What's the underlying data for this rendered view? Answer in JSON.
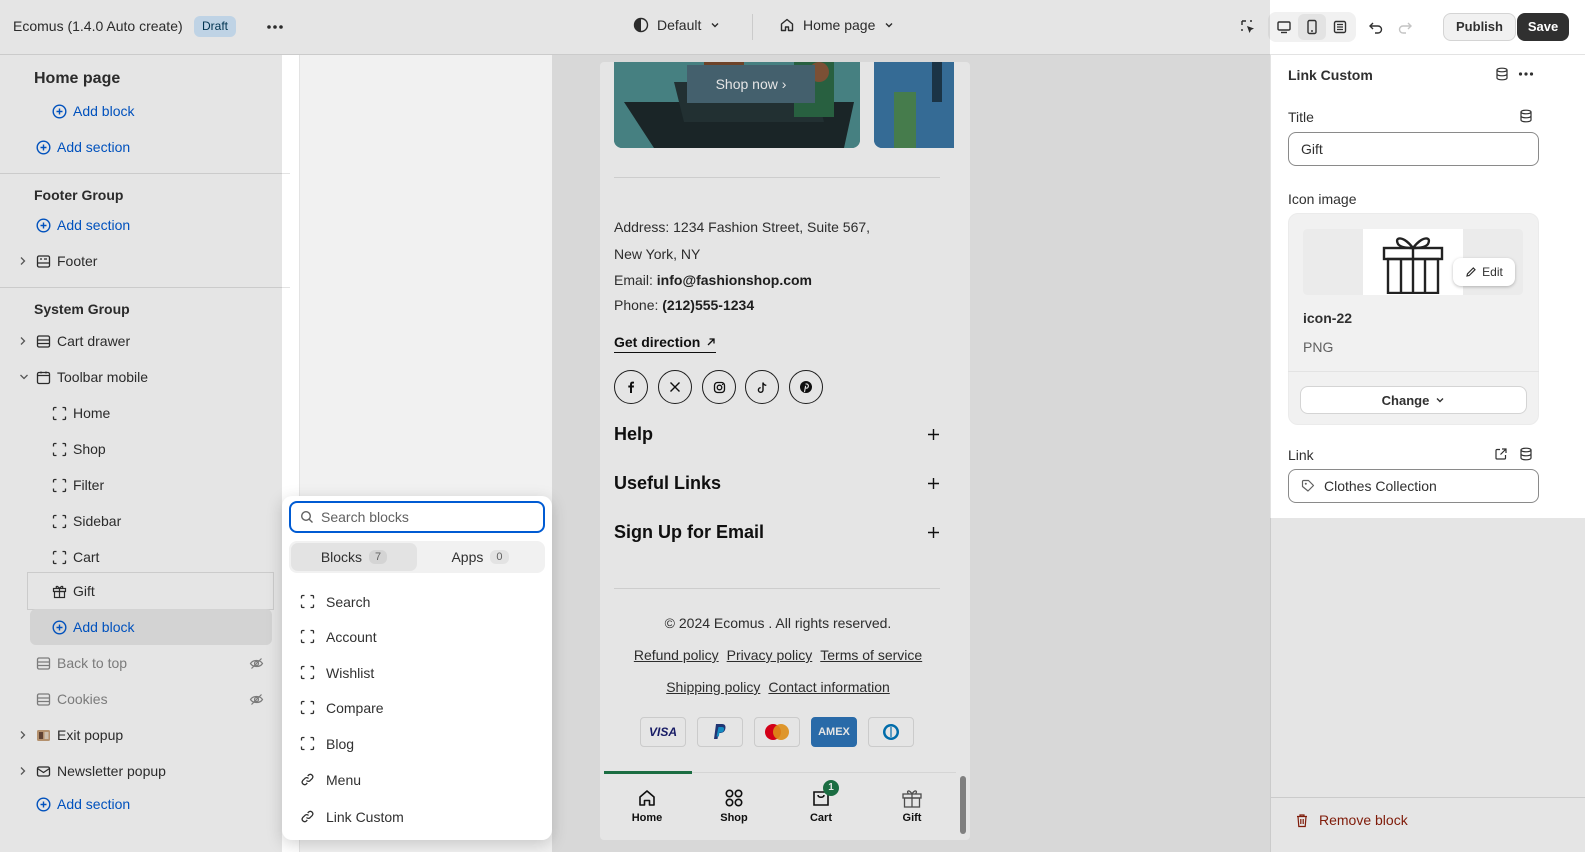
{
  "topbar": {
    "app_title": "Ecomus (1.4.0 Auto create)",
    "status_badge": "Draft",
    "theme_select": "Default",
    "page_select": "Home page",
    "publish_label": "Publish",
    "save_label": "Save"
  },
  "sidebar": {
    "title": "Home page",
    "add_block_top": "Add block",
    "add_section_1": "Add section",
    "footer_group": {
      "title": "Footer Group",
      "add_section": "Add section",
      "items": [
        "Footer"
      ]
    },
    "system_group": {
      "title": "System Group",
      "cart_drawer": "Cart drawer",
      "toolbar_mobile": "Toolbar mobile",
      "toolbar_children": [
        "Home",
        "Shop",
        "Filter",
        "Sidebar",
        "Cart",
        "Gift"
      ],
      "add_block": "Add block",
      "back_to_top": "Back to top",
      "cookies": "Cookies",
      "exit_popup": "Exit popup",
      "newsletter_popup": "Newsletter popup",
      "add_section": "Add section"
    }
  },
  "picker": {
    "search_placeholder": "Search blocks",
    "tabs": [
      {
        "label": "Blocks",
        "count": "7"
      },
      {
        "label": "Apps",
        "count": "0"
      }
    ],
    "items": [
      "Search",
      "Account",
      "Wishlist",
      "Compare",
      "Blog",
      "Menu",
      "Link Custom"
    ]
  },
  "preview": {
    "shop_now": "Shop now",
    "address_1": "Address: 1234 Fashion Street, Suite 567,",
    "address_2": "New York, NY",
    "email_label": "Email: ",
    "email_value": "info@fashionshop.com",
    "phone_label": "Phone: ",
    "phone_value": "(212)555-1234",
    "get_direction": "Get direction",
    "accordions": [
      "Help",
      "Useful Links",
      "Sign Up for Email"
    ],
    "copyright": "© 2024 Ecomus . All rights reserved.",
    "links_row1": [
      "Refund policy",
      "Privacy policy",
      "Terms of service"
    ],
    "links_row2": [
      "Shipping policy",
      "Contact information"
    ],
    "payments": [
      "VISA",
      "PayPal",
      "Mastercard",
      "AMEX",
      "Diners"
    ],
    "toolbar": [
      {
        "label": "Home",
        "icon": "home-icon"
      },
      {
        "label": "Shop",
        "icon": "grid-icon"
      },
      {
        "label": "Cart",
        "icon": "cart-icon",
        "badge": "1"
      },
      {
        "label": "Gift",
        "icon": "gift-icon"
      }
    ]
  },
  "panel": {
    "title": "Link Custom",
    "title_label": "Title",
    "title_value": "Gift",
    "icon_image_label": "Icon image",
    "image_name": "icon-22",
    "image_type": "PNG",
    "edit_label": "Edit",
    "change_label": "Change",
    "link_label": "Link",
    "link_value": "Clothes Collection",
    "remove_block": "Remove block"
  },
  "colors": {
    "accent": "#005bd3",
    "danger": "#8e1f0b",
    "primary_button": "#303030",
    "toolbar_active": "#1f7a4a"
  }
}
